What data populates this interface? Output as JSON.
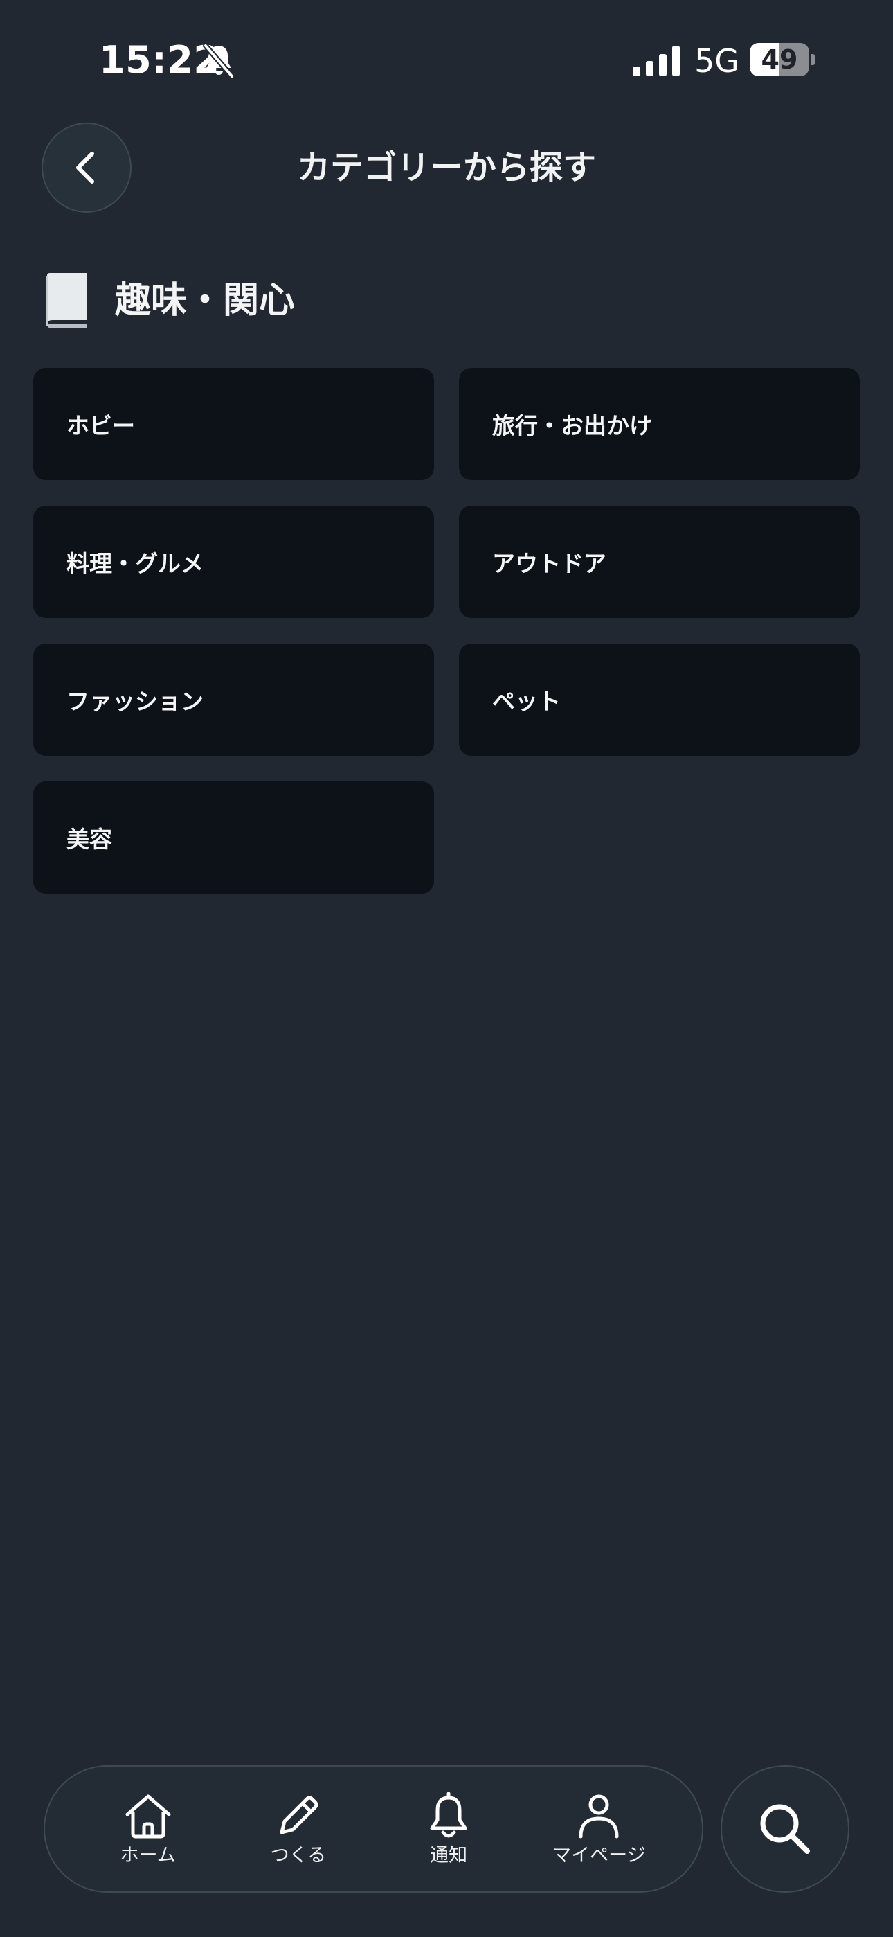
{
  "status_bar": {
    "time": "15:22",
    "network": "5G",
    "battery_level": "49",
    "battery_fraction": 0.49,
    "icons": [
      "bell-slash-icon",
      "signal-icon",
      "battery-icon"
    ]
  },
  "header": {
    "title": "カテゴリーから探す",
    "back_icon": "chevron-left-icon"
  },
  "section": {
    "icon": "book-icon",
    "title": "趣味・関心"
  },
  "categories": [
    {
      "label": "ホビー"
    },
    {
      "label": "旅行・お出かけ"
    },
    {
      "label": "料理・グルメ"
    },
    {
      "label": "アウトドア"
    },
    {
      "label": "ファッション"
    },
    {
      "label": "ペット"
    },
    {
      "label": "美容"
    }
  ],
  "bottom_nav": {
    "items": [
      {
        "label": "ホーム",
        "icon": "home-icon"
      },
      {
        "label": "つくる",
        "icon": "pencil-icon"
      },
      {
        "label": "通知",
        "icon": "bell-icon"
      },
      {
        "label": "マイページ",
        "icon": "user-icon"
      }
    ],
    "search_icon": "search-icon"
  },
  "colors": {
    "background": "#222831",
    "card": "#0c1218",
    "nav_background": "#232c34",
    "border": "#3e4953",
    "text": "#ffffff"
  }
}
